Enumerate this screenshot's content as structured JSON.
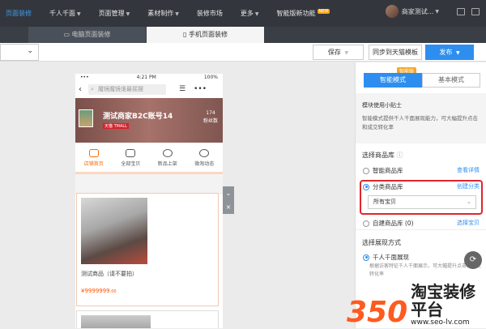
{
  "topnav": {
    "items": [
      {
        "label": "页面装修",
        "active": true,
        "caret": false
      },
      {
        "label": "千人千面",
        "caret": true
      },
      {
        "label": "页面管理",
        "caret": true
      },
      {
        "label": "素材制作",
        "caret": true
      },
      {
        "label": "装修市场",
        "caret": false
      },
      {
        "label": "更多",
        "caret": true
      },
      {
        "label": "智能版新功能",
        "caret": false
      }
    ],
    "new_badge": "NEW",
    "user": "商家测试..."
  },
  "tabs": {
    "pc": "电脑页面装修",
    "mobile": "手机页面装修"
  },
  "toolbar": {
    "save": "保存",
    "sync": "同步到天猫模板",
    "publish": "发布"
  },
  "phone": {
    "time": "4:21 PM",
    "battery": "100%",
    "search_placeholder": "魔镜魔镜谁最摇摆",
    "shop_name": "测试商家B2C账号14",
    "shop_badge": "天猫 TMALL",
    "fans_count": "174",
    "fans_label": "粉丝数",
    "nav": [
      "店铺首页",
      "全部宝贝",
      "新品上架",
      "微淘动态"
    ],
    "product_name": "测试商品（请不要拍）",
    "product_price": "¥9999999",
    "product_price_cents": ".00"
  },
  "panel": {
    "smart_badge": "智能版",
    "mode_smart": "智能模式",
    "mode_basic": "基本模式",
    "tip_title": "模块使用小贴士",
    "tip_body": "智能模式提供千人千面展现能力，可大幅提升点击和成交转化率",
    "library_label": "选择商品库",
    "opt_smart": "智能商品库",
    "link_detail": "查看详情",
    "opt_category": "分类商品库",
    "link_create": "创建分类",
    "select_value": "所有宝贝",
    "opt_custom": "自建商品库 (0)",
    "link_select": "选择宝贝",
    "display_label": "选择展现方式",
    "opt_thousand": "千人千面展现",
    "note": "根据访客特征千人千面展示，可大幅提升点击和成交转化率"
  },
  "watermark": {
    "num": "350",
    "cn": "淘宝装修平台",
    "url": "www.seo-lv.com"
  }
}
